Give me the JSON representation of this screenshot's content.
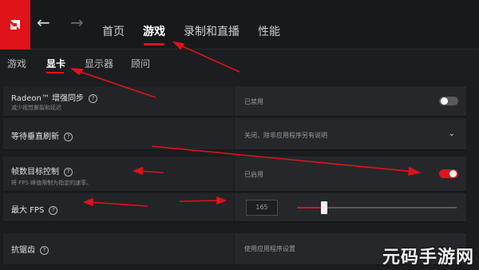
{
  "app": {
    "logo_text": "a"
  },
  "nav": {
    "back_icon": "←",
    "forward_icon": "→",
    "tabs": [
      {
        "label": "首页"
      },
      {
        "label": "游戏"
      },
      {
        "label": "录制和直播"
      },
      {
        "label": "性能"
      }
    ]
  },
  "subnav": {
    "tabs": [
      {
        "label": "游戏"
      },
      {
        "label": "显卡"
      },
      {
        "label": "显示器"
      },
      {
        "label": "顾问"
      }
    ]
  },
  "settings": {
    "chill": {
      "label": "Radeon™ 增强同步",
      "sublabel": "减少视觉撕裂和延迟",
      "value": "已禁用",
      "enabled": false
    },
    "vsync": {
      "label": "等待垂直刷新",
      "value": "关闭，除非应用程序另有说明"
    },
    "frtc": {
      "label": "帧数目标控制",
      "sublabel": "将 FPS 峰值限制为指定的速率。",
      "value": "已启用",
      "enabled": true
    },
    "max_fps": {
      "label": "最大 FPS",
      "value": "165",
      "slider_fraction": 0.17
    },
    "aa": {
      "label": "抗锯齿",
      "value": "使用应用程序设置"
    }
  },
  "help_icon_text": "?",
  "chevron_icon": "⌄",
  "watermark": "元码手游网",
  "colors": {
    "accent": "#e0121a",
    "background": "#1b1c1f",
    "row": "#232428"
  }
}
